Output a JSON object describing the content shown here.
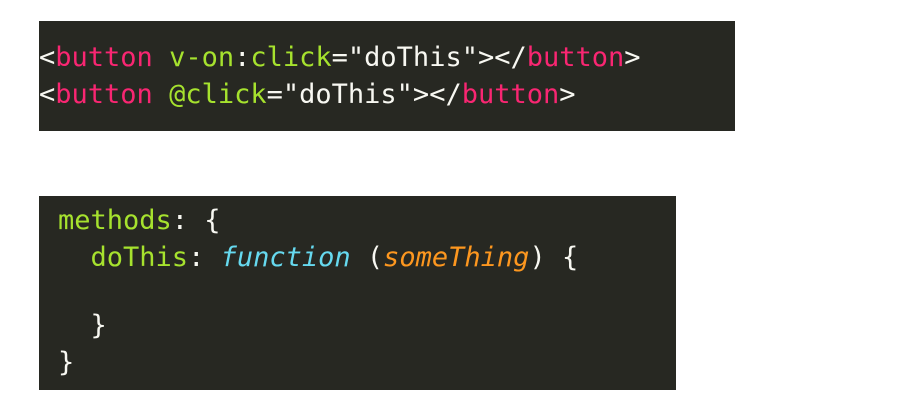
{
  "colors": {
    "background": "#ffffff",
    "code_background": "#272822",
    "tag": "#f92672",
    "attribute": "#a6e22e",
    "text": "#f8f8f2",
    "keyword": "#66d9ef",
    "parameter": "#fd971f"
  },
  "template_block": {
    "line1": {
      "open_bracket": "<",
      "tag": "button",
      "space": " ",
      "attr_directive": "v-on",
      "colon": ":",
      "attr_event": "click",
      "equals_value": "=\"doThis\">",
      "close_open": "</",
      "close_tag": "button",
      "close_bracket": ">"
    },
    "line2": {
      "open_bracket": "<",
      "tag": "button",
      "space": " ",
      "attr_shorthand": "@click",
      "equals_value": "=\"doThis\">",
      "close_open": "</",
      "close_tag": "button",
      "close_bracket": ">"
    }
  },
  "script_block": {
    "line1": {
      "key": "methods",
      "rest": ": {"
    },
    "line2": {
      "indent": "  ",
      "key": "doThis",
      "colon": ": ",
      "keyword": "function",
      "paren_open": " (",
      "param": "someThing",
      "paren_close": ") {"
    },
    "line4": {
      "text": "  }"
    },
    "line5": {
      "text": "}"
    }
  }
}
